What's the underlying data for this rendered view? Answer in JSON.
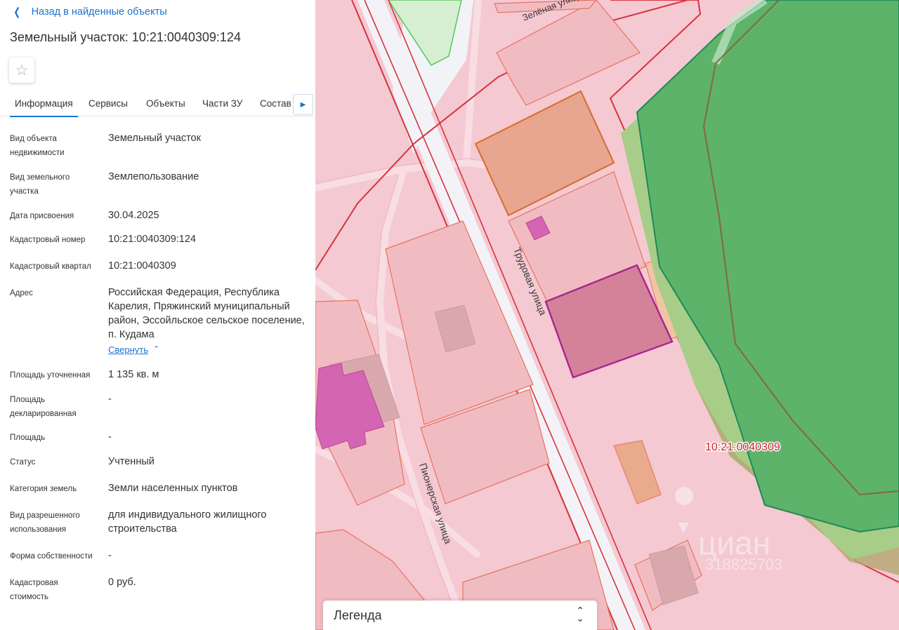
{
  "header": {
    "back_label": "Назад в найденные объекты",
    "title": "Земельный участок: 10:21:0040309:124"
  },
  "icons": {
    "back": "chevron-left-icon",
    "favorite": "star-outline-icon",
    "tabs_next": "chevron-right-icon",
    "collapse": "chevron-up-icon",
    "legend_toggle": "unfold-icon"
  },
  "tabs": [
    {
      "label": "Информация",
      "active": true
    },
    {
      "label": "Сервисы",
      "active": false
    },
    {
      "label": "Объекты",
      "active": false
    },
    {
      "label": "Части ЗУ",
      "active": false
    },
    {
      "label": "Состав",
      "active": false
    }
  ],
  "fields": [
    {
      "label": "Вид объекта недвижимости",
      "value": "Земельный участок"
    },
    {
      "label": "Вид земельного участка",
      "value": "Землепользование"
    },
    {
      "label": "Дата присвоения",
      "value": "30.04.2025"
    },
    {
      "label": "Кадастровый номер",
      "value": "10:21:0040309:124"
    },
    {
      "label": "Кадастровый квартал",
      "value": "10:21:0040309"
    },
    {
      "label": "Адрес",
      "value": "Российская Федерация, Республика Карелия, Пряжинский муниципальный район, Эссойльское сельское поселение, п. Кудама"
    },
    {
      "label": "Площадь уточненная",
      "value": "1 135 кв. м"
    },
    {
      "label": "Площадь декларированная",
      "value": "-"
    },
    {
      "label": "Площадь",
      "value": "-"
    },
    {
      "label": "Статус",
      "value": "Учтенный"
    },
    {
      "label": "Категория земель",
      "value": "Земли населенных пунктов"
    },
    {
      "label": "Вид разрешенного использования",
      "value": "для индивидуального жилищного строительства"
    },
    {
      "label": "Форма собственности",
      "value": "-"
    },
    {
      "label": "Кадастровая стоимость",
      "value": "0 руб."
    }
  ],
  "address_collapse_label": "Свернуть",
  "map": {
    "street_labels": [
      "Трудовая улица",
      "Пионерская улица",
      "Зелёная улица"
    ],
    "quarter_label": "10:21:0040309",
    "watermark_brand": "циан",
    "watermark_id": "318825703",
    "colors": {
      "land_fill": "#f4c9d2",
      "parcel_fill": "#f1bcc1",
      "selected_fill": "#d4819a",
      "forest_fill": "#5db36a",
      "quarter_border": "#d8333f",
      "selected_border": "#a8268c"
    }
  },
  "legend": {
    "label": "Легенда"
  }
}
